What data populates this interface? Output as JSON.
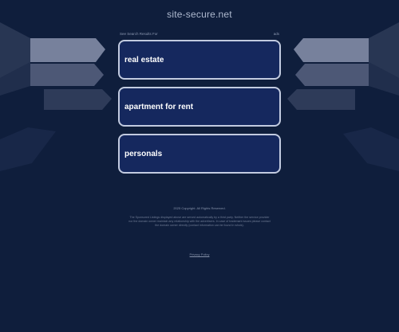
{
  "header": {
    "domain": "site-secure.net"
  },
  "related": {
    "heading": "See Search Results For",
    "right_label": "ads"
  },
  "links": [
    {
      "label": "real estate"
    },
    {
      "label": "apartment for rent"
    },
    {
      "label": "personals"
    }
  ],
  "footer": {
    "copyright": "2025 Copyright. All Rights Reserved.",
    "disclaimer": "The Sponsored Listings displayed above are served automatically by a third party. Neither the service provider nor the domain owner maintain any relationship with the advertisers. In case of trademark issues please contact the domain owner directly (contact information can be found in whois).",
    "privacy": "Privacy Policy"
  },
  "colors": {
    "background": "#0f1e3c",
    "box_fill": "#15285e",
    "box_border": "#c2cbe0"
  }
}
